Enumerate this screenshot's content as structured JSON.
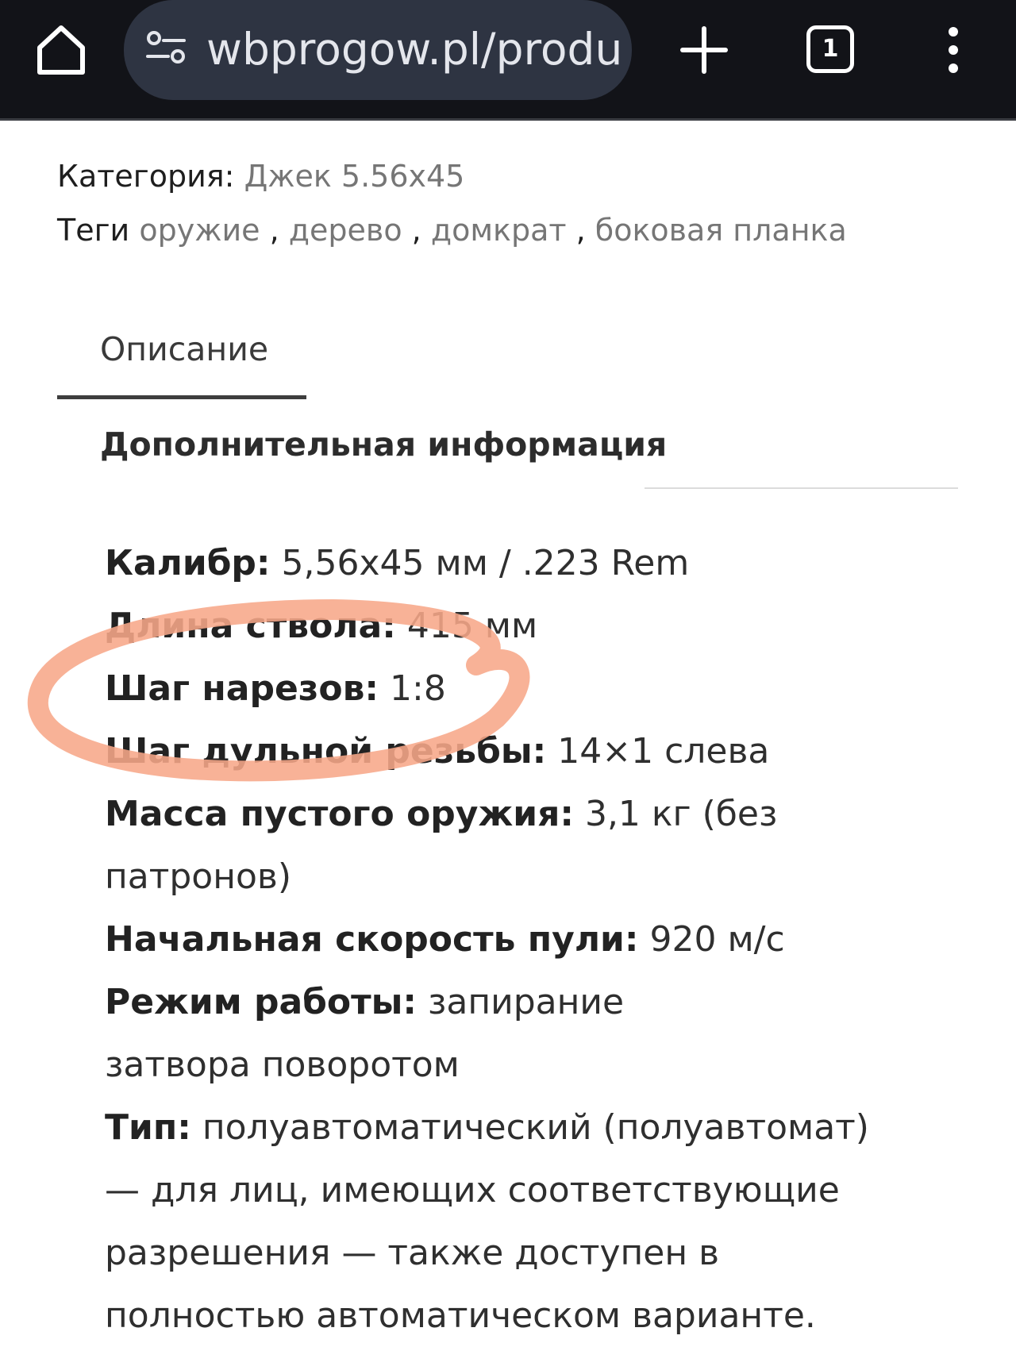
{
  "browser": {
    "url": "wbprogow.pl/produk",
    "tab_count": "1",
    "icons": {
      "home": "home-icon",
      "site_settings": "site-settings-icon",
      "new_tab": "plus-icon",
      "menu": "kebab-menu-icon"
    }
  },
  "product_meta": {
    "category_label": "Категория:",
    "category_value": "Джек 5.56x45",
    "tags_label": "Теги",
    "tags": [
      "оружие",
      "дерево",
      "домкрат",
      "боковая планка"
    ],
    "separator": " , "
  },
  "tabs": [
    {
      "label": "Описание",
      "active": true
    },
    {
      "label": "Дополнительная информация",
      "active": false
    }
  ],
  "specs": [
    {
      "label": "Калибр:",
      "value": "5,56x45 мм / .223 Rem"
    },
    {
      "label": "Длина ствола:",
      "value": "415 мм"
    },
    {
      "label": "Шаг нарезов:",
      "value": "1:8"
    },
    {
      "label": "Шаг дульной резьбы:",
      "value": "14×1 слева"
    },
    {
      "label": "Масса пустого оружия:",
      "value": "3,1 кг (без патронов)"
    },
    {
      "label": "Начальная скорость пули:",
      "value": "920 м/с"
    },
    {
      "label": "Режим работы:",
      "value": "запирание затвора поворотом"
    },
    {
      "label": "Тип:",
      "value": "полуавтоматический (полуавтомат) — для лиц, имеющих соответствующие разрешения — также доступен в полностью автоматическом варианте."
    }
  ],
  "annotation": {
    "color": "#f7a789",
    "highlighted_spec": "Шаг нарезов:"
  },
  "colors": {
    "toolbar_bg": "#121318",
    "url_pill_bg": "#2e3442",
    "link_gray": "#767676"
  }
}
